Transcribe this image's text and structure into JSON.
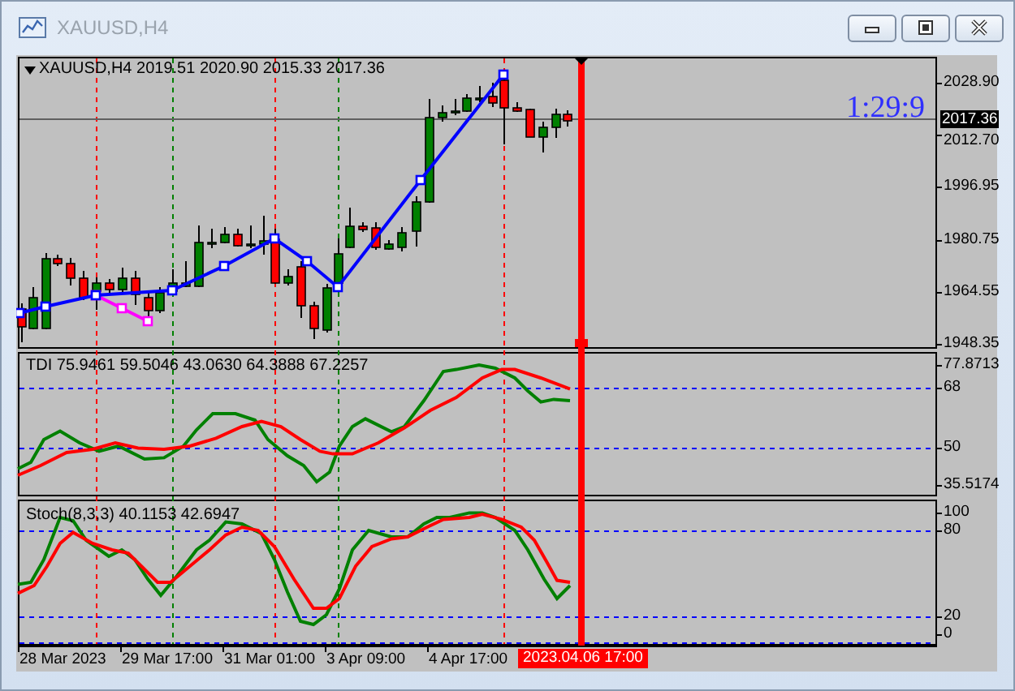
{
  "window": {
    "title": "XAUUSD,H4"
  },
  "main_pane": {
    "symbol": "XAUUSD,H4",
    "ohlc": "2019.51 2020.90 2015.33 2017.36",
    "timer": "1:29:9",
    "current_price": "2017.36",
    "price_labels": [
      "2028.90",
      "2012.70",
      "1996.95",
      "1980.75",
      "1964.55",
      "1948.35"
    ]
  },
  "indicators": [
    {
      "kind": "tdi",
      "legend": "TDI 75.9461 59.5046 43.0630 64.3888 67.2257",
      "scale_labels": [
        "77.8713",
        "68",
        "50",
        "35.5174"
      ]
    },
    {
      "kind": "stoch",
      "legend": "Stoch(8,3,3) 40.1153 42.6947",
      "scale_labels": [
        "100",
        "80",
        "20",
        "0"
      ]
    }
  ],
  "time_axis": {
    "labels": [
      "28 Mar 2023",
      "29 Mar 17:00",
      "31 Mar 01:00",
      "3 Apr 09:00",
      "4 Apr 17:00"
    ],
    "cursor_label": "2023.04.06 17:00"
  }
}
